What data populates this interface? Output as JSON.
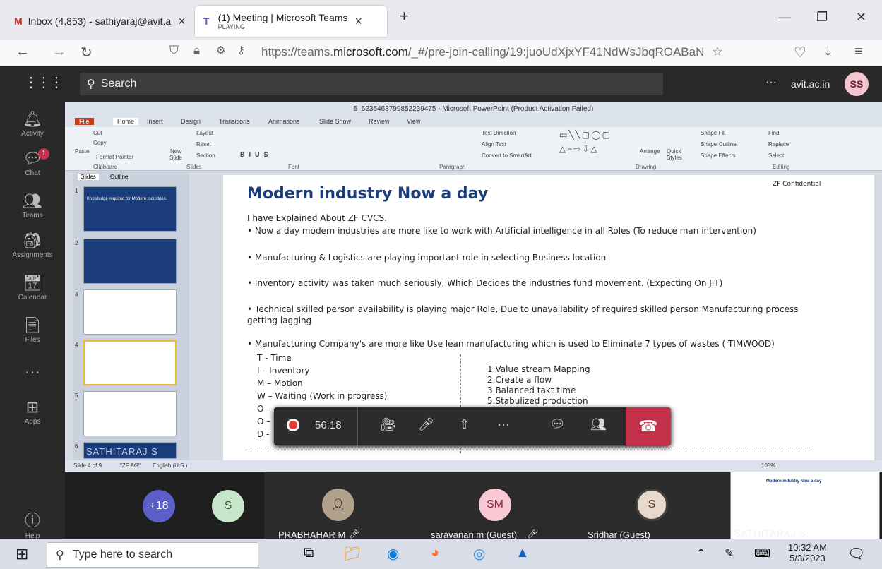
{
  "browser": {
    "tabs": [
      {
        "title": "Inbox (4,853) - sathiyaraj@avit.a"
      },
      {
        "title": "(1) Meeting | Microsoft Teams",
        "subtitle": "PLAYING"
      }
    ],
    "url_prefix": "https://teams.",
    "url_domain": "microsoft.com",
    "url_suffix": "/_#/pre-join-calling/19:juoUdXjxYF41NdWsJbqROABaN"
  },
  "teams": {
    "search_placeholder": "Search",
    "org": "avit.ac.in",
    "user_initials": "SS",
    "rail": [
      {
        "label": "Activity"
      },
      {
        "label": "Chat",
        "badge": "1"
      },
      {
        "label": "Teams"
      },
      {
        "label": "Assignments"
      },
      {
        "label": "Calendar"
      },
      {
        "label": "Files"
      },
      {
        "label": "Apps"
      },
      {
        "label": "Help"
      }
    ]
  },
  "ppt": {
    "window_title": "5_623546379985223947​5 - Microsoft PowerPoint (Product Activation Failed)",
    "ribbon_tabs": [
      "File",
      "Home",
      "Insert",
      "Design",
      "Transitions",
      "Animations",
      "Slide Show",
      "Review",
      "View"
    ],
    "groups": [
      "Clipboard",
      "Slides",
      "Font",
      "Paragraph",
      "Drawing",
      "Editing"
    ],
    "buttons": {
      "cut": "Cut",
      "copy": "Copy",
      "paste": "Paste",
      "format_painter": "Format Painter",
      "new_slide": "New Slide",
      "layout": "Layout",
      "reset": "Reset",
      "section": "Section",
      "text_direction": "Text Direction",
      "align_text": "Align Text",
      "convert_smartart": "Convert to SmartArt",
      "arrange": "Arrange",
      "quick_styles": "Quick Styles",
      "shape_fill": "Shape Fill",
      "shape_outline": "Shape Outline",
      "shape_effects": "Shape Effects",
      "find": "Find",
      "replace": "Replace",
      "select": "Select"
    },
    "pane_tabs": [
      "Slides",
      "Outline"
    ],
    "thumb_titles": [
      "Knowledge required for Modern Industries.",
      "",
      "",
      "",
      "",
      ""
    ],
    "slide": {
      "title": "Modern industry Now a day",
      "confidential": "ZF Confidential",
      "intro": "I have Explained About ZF CVCS.",
      "bullets": [
        "Now a day modern industries are more like to work with Artificial intelligence in all Roles (To reduce man intervention)",
        "Manufacturing & Logistics are playing important role in selecting Business location",
        "Inventory activity was taken much seriously, Which Decides the industries fund movement. (Expecting On JIT)",
        "Technical skilled person availability is playing major Role, Due to unavailability of required skilled person Manufacturing process getting lagging",
        "Manufacturing Company's are more like Use lean manufacturing which is used to Eliminate 7 types of wastes ( TIMWOOD)"
      ],
      "wastes": [
        "T - Time",
        "I – Inventory",
        "M – Motion",
        "W – Waiting (Work in progress)",
        "O –",
        "O –",
        "D -"
      ],
      "steps": [
        "1.Value stream Mapping",
        "2.Create a flow",
        "3.Balanced takt time",
        "5.Stabulized production"
      ]
    },
    "status": {
      "slide": "Slide 4 of 9",
      "theme": "\"ZF AG\"",
      "lang": "English (U.S.)",
      "zoom": "108%"
    }
  },
  "call": {
    "duration": "56:18"
  },
  "participants": [
    {
      "initials": "+18",
      "color": "#5b5fc7"
    },
    {
      "initials": "S",
      "color": "#c8e6c9"
    },
    {
      "name": "PRABHAHAR M"
    },
    {
      "initials": "SM",
      "name": "saravanan m (Guest)",
      "color": "#f8c9d4"
    },
    {
      "initials": "S",
      "name": "Sridhar (Guest)",
      "color": "#e8d9cd"
    }
  ],
  "watermark": "SATHITARAJ S",
  "taskbar": {
    "search": "Type here to search",
    "time": "10:32 AM",
    "date": "5/3/2023"
  }
}
